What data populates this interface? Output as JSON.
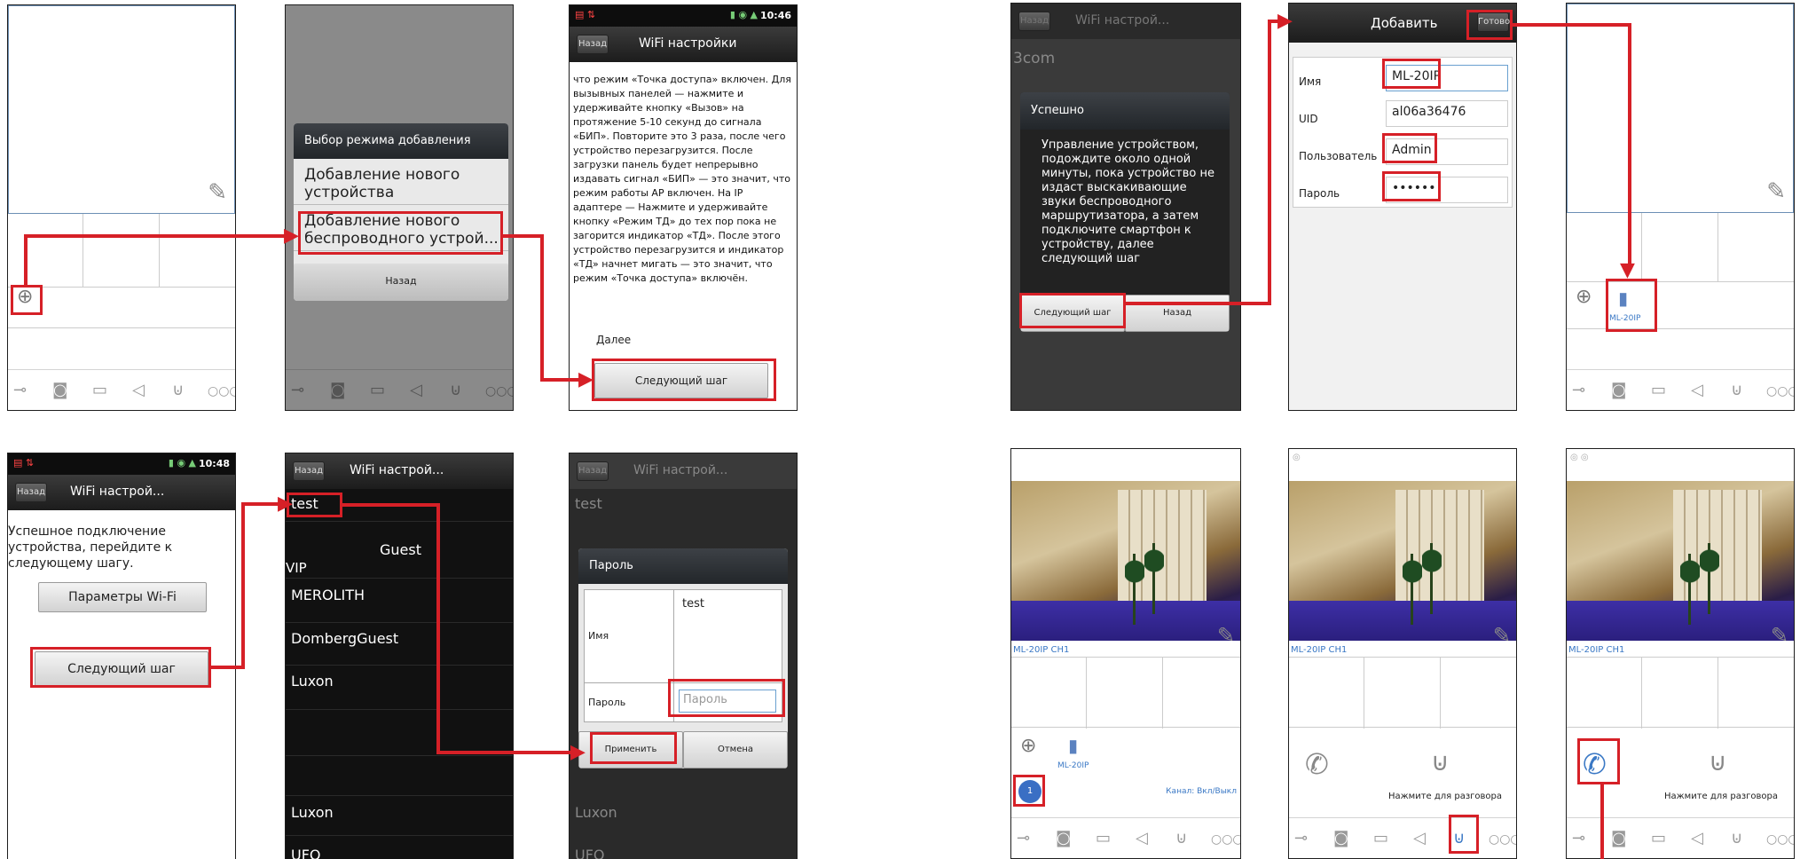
{
  "common": {
    "back": "Назад",
    "time1": "10:46",
    "time2": "10:48",
    "add_icon": "plus-circle-icon",
    "toolbar_icons": [
      "key-icon",
      "camera-icon",
      "video-icon",
      "speaker-icon",
      "microphone-icon",
      "more-icon"
    ]
  },
  "s1": {},
  "s2": {
    "dialog_title": "Выбор режима добавления",
    "opt1_l1": "Добавление нового",
    "opt1_l2": "устройства",
    "opt2_l1": "Добавление нового",
    "opt2_l2": "беспроводного устрой...",
    "back": "Назад"
  },
  "s3": {
    "title": "WiFi настройки",
    "text": "что режим «Точка доступа» включен. Для вызывных панелей — нажмите и удерживайте кнопку «Вызов» на протяжение 5-10 секунд до сигнала «БИП». Повторите это 3 раза, после чего устройство перезагрузится. После загрузки панель будет непрерывно издавать сигнал «БИП» — это значит, что режим работы AP включен. На IP адаптере — Нажмите и удерживайте кнопку «Режим ТД» до тех пор пока не загорится индикатор «ТД». После этого устройство перезагрузится и индикатор «ТД» начнет мигать — это значит, что режим «Точка доступа» включён.",
    "more": "Далее",
    "next": "Следующий шаг"
  },
  "s4": {
    "title": "WiFi настрой...",
    "text_l1": "Успешное подключение",
    "text_l2": "устройства, перейдите к",
    "text_l3": "следующему шагу.",
    "wifi_params": "Параметры Wi-Fi",
    "next": "Следующий шаг"
  },
  "s5": {
    "title": "WiFi настрой...",
    "networks": [
      "test",
      "Guest",
      "VIP",
      "MEROLITH",
      "DombergGuest",
      "Luxon",
      "Luxon",
      "UFO"
    ]
  },
  "s6": {
    "title": "WiFi настрой...",
    "bg_test": "test",
    "bg_luxon": "Luxon",
    "bg_ufo": "UFO",
    "dialog_title": "Пароль",
    "name_label": "Имя",
    "name_value": "test",
    "pass_label": "Пароль",
    "pass_placeholder": "Пароль",
    "apply": "Применить",
    "cancel": "Отмена"
  },
  "s7": {
    "title": "WiFi настрой...",
    "bg_text": "3com",
    "dialog_title": "Успешно",
    "text": "Управление устройством, подождите около одной минуты, пока устройство не издаст выскакивающие звуки беспроводного маршрутизатора, а затем подключите смартфон к устройству, далее следующий шаг",
    "next": "Следующий шаг",
    "back": "Назад"
  },
  "s8": {
    "title": "Добавить",
    "done": "Готово",
    "name_label": "Имя",
    "name_value": "ML-20IP",
    "uid_label": "UID",
    "uid_value": "al06a36476",
    "user_label": "Пользователь",
    "user_value": "Admin",
    "pass_label": "Пароль",
    "pass_value": "••••••"
  },
  "s9": {
    "device": "ML-20IP"
  },
  "s10": {
    "channel_label": "ML-20IP CH1",
    "device": "ML-20IP",
    "badge": "1",
    "channel_toggle": "Канал: Вкл/Выкл"
  },
  "s11": {
    "channel_label": "ML-20IP CH1",
    "talk": "Нажмите для разговора"
  },
  "s12": {
    "channel_label": "ML-20IP CH1",
    "talk": "Нажмите для разговора"
  }
}
